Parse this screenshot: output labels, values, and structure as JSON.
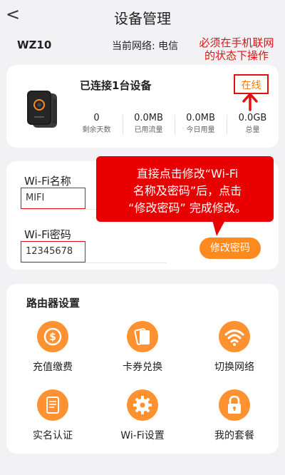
{
  "header": {
    "back_icon": "chevron-left-icon",
    "back": "<",
    "title": "设备管理"
  },
  "device": {
    "name": "WZ10",
    "network": "当前网络: 电信"
  },
  "annotation_top": {
    "line1": "必须在手机联网",
    "line2": "的状态下操作"
  },
  "status": {
    "connected": "已连接1台设备",
    "online": "在线",
    "stats": [
      {
        "value": "0",
        "label": "剩余天数"
      },
      {
        "value": "0.0MB",
        "label": "已用流量"
      },
      {
        "value": "0.0MB",
        "label": "今日用量"
      },
      {
        "value": "0.0GB",
        "label": "总量"
      }
    ]
  },
  "wifi": {
    "name_label": "Wi-Fi名称",
    "name_value": "MIFI",
    "password_label": "Wi-Fi密码",
    "password_value": "12345678",
    "modify_button": "修改密码"
  },
  "callout": {
    "line1": "直接点击修改“Wi-Fi",
    "line2": "名称及密码”后，点击",
    "line3": "“修改密码” 完成修改。"
  },
  "router": {
    "title": "路由器设置",
    "items": [
      {
        "label": "充值缴费",
        "icon": "dollar-icon"
      },
      {
        "label": "卡券兑换",
        "icon": "card-icon"
      },
      {
        "label": "切换网络",
        "icon": "wifi-icon"
      },
      {
        "label": "实名认证",
        "icon": "document-icon"
      },
      {
        "label": "Wi-Fi设置",
        "icon": "gear-icon"
      },
      {
        "label": "我的套餐",
        "icon": "lock-icon"
      }
    ]
  },
  "colors": {
    "accent": "#ff8a1f",
    "annotation_red": "#e01010",
    "background": "#f2f2f4"
  }
}
